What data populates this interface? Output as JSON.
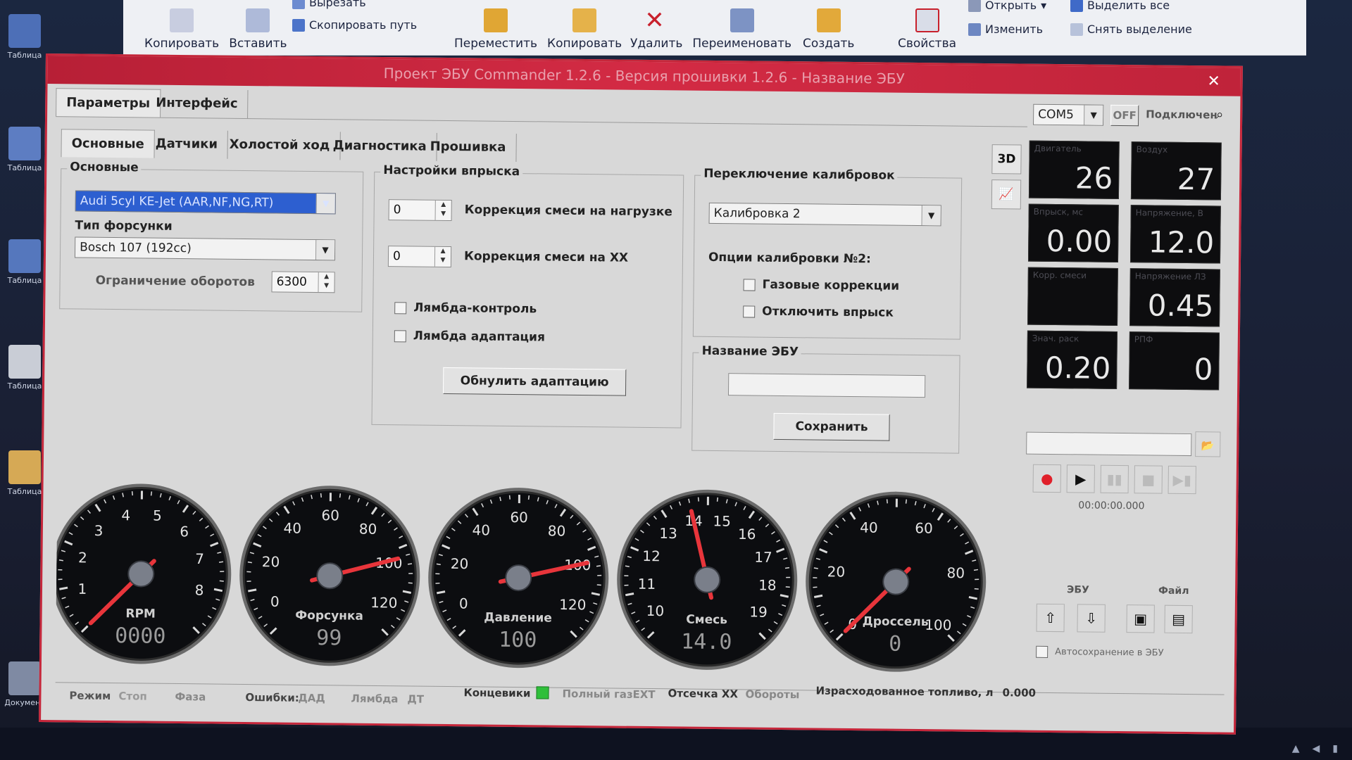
{
  "ribbon": {
    "copy": "Копировать",
    "paste": "Вставить",
    "cut": "Вырезать",
    "copy_path": "Скопировать путь",
    "move": "Переместить",
    "copy_to": "Копировать",
    "delete": "Удалить",
    "rename": "Переименовать",
    "create": "Создать",
    "properties": "Свойства",
    "open": "Открыть",
    "edit": "Изменить",
    "select_all": "Выделить все",
    "deselect": "Снять выделение"
  },
  "desktop_icons": [
    "Таблица",
    "Таблица",
    "Таблица",
    "Таблица",
    "Таблица",
    "Документ"
  ],
  "window": {
    "title": "Проект ЭБУ Commander 1.2.6 - Версия прошивки 1.2.6 - Название ЭБУ",
    "main_tabs": [
      "Параметры",
      "Интерфейс"
    ],
    "sub_tabs": [
      "Основные",
      "Датчики",
      "Холостой ход",
      "Диагностика",
      "Прошивка"
    ]
  },
  "basic": {
    "group": "Основные",
    "engine_type": "Audi 5cyl KE-Jet (AAR,NF,NG,RT)",
    "injector_label": "Тип форсунки",
    "injector_value": "Bosch 107 (192cc)",
    "rev_limit_label": "Ограничение оборотов",
    "rev_limit_value": "6300"
  },
  "injection": {
    "group": "Настройки впрыска",
    "load_corr_value": "0",
    "load_corr_label": "Коррекция смеси на нагрузке",
    "idle_corr_value": "0",
    "idle_corr_label": "Коррекция смеси на ХХ",
    "lambda_control": "Лямбда-контроль",
    "lambda_adapt": "Лямбда адаптация",
    "reset_adapt": "Обнулить адаптацию"
  },
  "calibration": {
    "group": "Переключение калибровок",
    "selected": "Калибровка 2",
    "options_label": "Опции калибровки №2:",
    "gas_corr": "Газовые коррекции",
    "disable_injection": "Отключить впрыск"
  },
  "ecu_name": {
    "group": "Название ЭБУ",
    "value": "",
    "save": "Сохранить"
  },
  "connection": {
    "port": "COM5",
    "state": "OFF",
    "status": "Подключен"
  },
  "side_buttons": {
    "threed": "3D"
  },
  "readouts": [
    {
      "label": "Двигатель",
      "value": "26"
    },
    {
      "label": "Воздух",
      "value": "27"
    },
    {
      "label": "Впрыск, мс",
      "value": "0.00"
    },
    {
      "label": "Напряжение, В",
      "value": "12.0"
    },
    {
      "label": "Корр. смеси",
      "value": ""
    },
    {
      "label": "Напряжение ЛЗ",
      "value": "0.45"
    },
    {
      "label": "Знач. раск",
      "value": "0.20"
    },
    {
      "label": "РПФ",
      "value": "0"
    }
  ],
  "log": {
    "timer": "00:00:00.000",
    "ecu_label": "ЭБУ",
    "file_label": "Файл",
    "autosave": "Автосохранение в ЭБУ"
  },
  "gauges": [
    {
      "name": "RPM",
      "readout": "0000",
      "ticks": [
        "1",
        "2",
        "3",
        "4",
        "5",
        "6",
        "7",
        "8"
      ],
      "min": 0,
      "max": 9,
      "value": 0
    },
    {
      "name": "Форсунка",
      "readout": "99",
      "ticks": [
        "0",
        "20",
        "40",
        "60",
        "80",
        "100",
        "120"
      ],
      "min": -10,
      "max": 130,
      "value": 99
    },
    {
      "name": "Давление",
      "readout": "100",
      "ticks": [
        "0",
        "20",
        "40",
        "60",
        "80",
        "100",
        "120"
      ],
      "min": -10,
      "max": 130,
      "value": 100
    },
    {
      "name": "Смесь",
      "readout": "14.0",
      "ticks": [
        "10",
        "11",
        "12",
        "13",
        "14",
        "15",
        "16",
        "17",
        "18",
        "19"
      ],
      "min": 9.5,
      "max": 19.5,
      "value": 14.0
    },
    {
      "name": "Дроссель",
      "readout": "0",
      "ticks": [
        "0",
        "20",
        "40",
        "60",
        "80",
        "100"
      ],
      "min": 0,
      "max": 100,
      "value": 0
    }
  ],
  "statusbar": {
    "mode": "Режим",
    "mode_val": "Стоп",
    "phase": "Фаза",
    "errors": "Ошибки:",
    "dad": "ДАД",
    "lambda": "Лямбда",
    "dt": "ДТ",
    "limit_switches": "Концевики",
    "full_gas": "Полный газ",
    "ext": "EXT",
    "cutoff": "Отсечка ХХ",
    "revs": "Обороты",
    "fuel_used": "Израсходованное топливо, л",
    "fuel_val": "0.000"
  },
  "colors": {
    "title": "#c5263a",
    "accent_selected": "#2d5fd0",
    "needle": "#e8353b",
    "ok_indicator": "#2fbf3a"
  }
}
